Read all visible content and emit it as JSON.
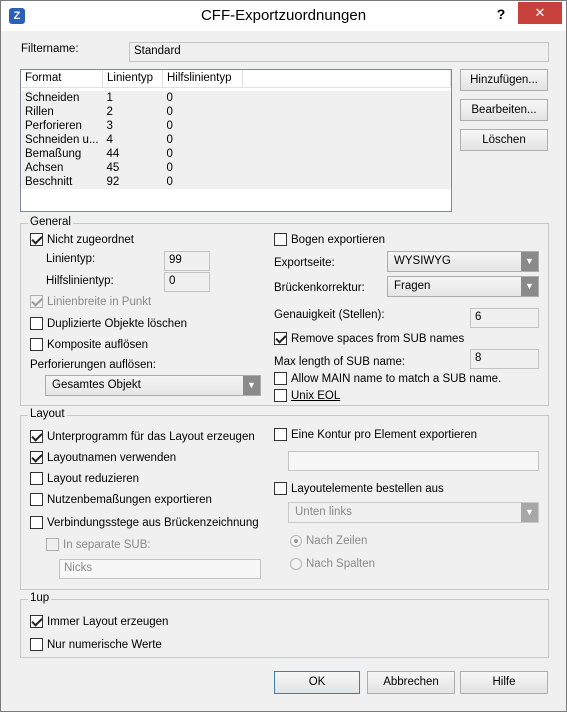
{
  "window": {
    "title": "CFF-Exportzuordnungen",
    "help": "?",
    "close": "✕"
  },
  "filtername": {
    "label": "Filtername:",
    "value": "Standard"
  },
  "table": {
    "headers": [
      "Format",
      "Linientyp",
      "Hilfslinientyp"
    ],
    "rows": [
      [
        "Schneiden",
        "1",
        "0"
      ],
      [
        "Rillen",
        "2",
        "0"
      ],
      [
        "Perforieren",
        "3",
        "0"
      ],
      [
        "Schneiden u...",
        "4",
        "0"
      ],
      [
        "Bemaßung",
        "44",
        "0"
      ],
      [
        "Achsen",
        "45",
        "0"
      ],
      [
        "Beschnitt",
        "92",
        "0"
      ]
    ]
  },
  "side_buttons": {
    "add": "Hinzufügen...",
    "edit": "Bearbeiten...",
    "delete": "Löschen"
  },
  "general": {
    "title": "General",
    "nicht_zugeordnet": "Nicht zugeordnet",
    "linientyp_label": "Linientyp:",
    "linientyp_value": "99",
    "hilfslinientyp_label": "Hilfslinientyp:",
    "hilfslinientyp_value": "0",
    "linienbreite": "Linienbreite in Punkt",
    "duplizierte": "Duplizierte Objekte löschen",
    "komposite": "Komposite auflösen",
    "perforierungen_label": "Perforierungen auflösen:",
    "perforierungen_value": "Gesamtes Objekt",
    "bogen": "Bogen exportieren",
    "exportseite_label": "Exportseite:",
    "exportseite_value": "WYSIWYG",
    "brueckenkorrektur_label": "Brückenkorrektur:",
    "brueckenkorrektur_value": "Fragen",
    "genauigkeit_label": "Genauigkeit (Stellen):",
    "genauigkeit_value": "6",
    "remove_spaces": "Remove spaces from SUB names",
    "maxlen_label": "Max length of SUB name:",
    "maxlen_value": "8",
    "allow_main": "Allow MAIN name to match a SUB name.",
    "unix_eol": "Unix EOL"
  },
  "layout": {
    "title": "Layout",
    "unterprogramm": "Unterprogramm für das Layout erzeugen",
    "layoutnamen": "Layoutnamen verwenden",
    "reduzieren": "Layout reduzieren",
    "nutzen": "Nutzenbemaßungen exportieren",
    "verbindungsstege": "Verbindungsstege aus Brückenzeichnung exp",
    "separate_sub": "In separate SUB:",
    "nicks": "Nicks",
    "eine_kontur": "Eine Kontur pro Element exportieren",
    "kontur_value": "",
    "bestellen": "Layoutelemente bestellen aus",
    "bestellen_value": "Unten links",
    "nach_zeilen": "Nach Zeilen",
    "nach_spalten": "Nach Spalten"
  },
  "oneup": {
    "title": "1up",
    "immer": "Immer Layout erzeugen",
    "numerisch": "Nur numerische Werte"
  },
  "footer": {
    "ok": "OK",
    "cancel": "Abbrechen",
    "help": "Hilfe"
  }
}
